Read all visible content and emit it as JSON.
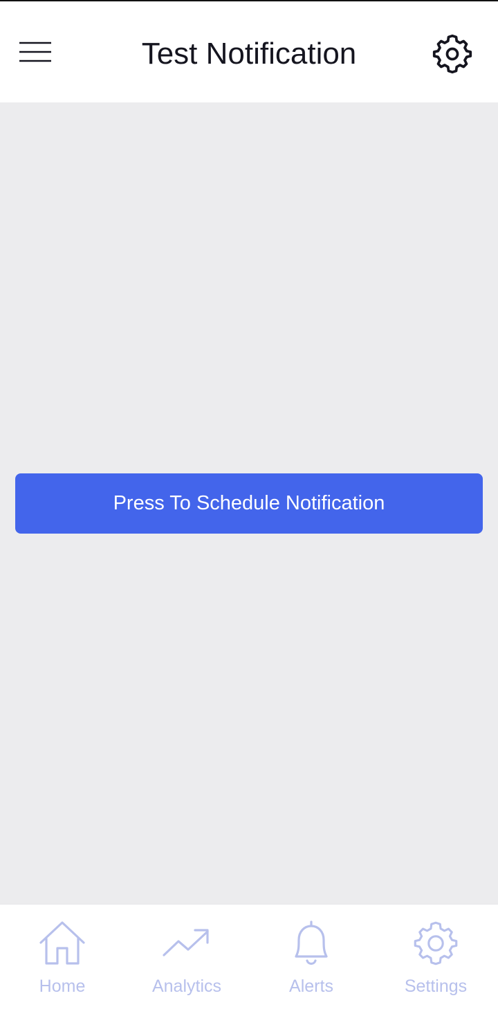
{
  "header": {
    "title": "Test Notification",
    "menu_icon": "hamburger-menu-icon",
    "settings_icon": "gear-icon"
  },
  "main": {
    "schedule_button_label": "Press To Schedule Notification"
  },
  "bottom_nav": {
    "items": [
      {
        "label": "Home",
        "icon": "home-icon"
      },
      {
        "label": "Analytics",
        "icon": "trending-up-icon"
      },
      {
        "label": "Alerts",
        "icon": "bell-icon"
      },
      {
        "label": "Settings",
        "icon": "gear-icon"
      }
    ]
  },
  "colors": {
    "primary": "#4365eb",
    "background": "#ececee",
    "header_text": "#15151f",
    "nav_inactive": "#b7c0ec"
  }
}
